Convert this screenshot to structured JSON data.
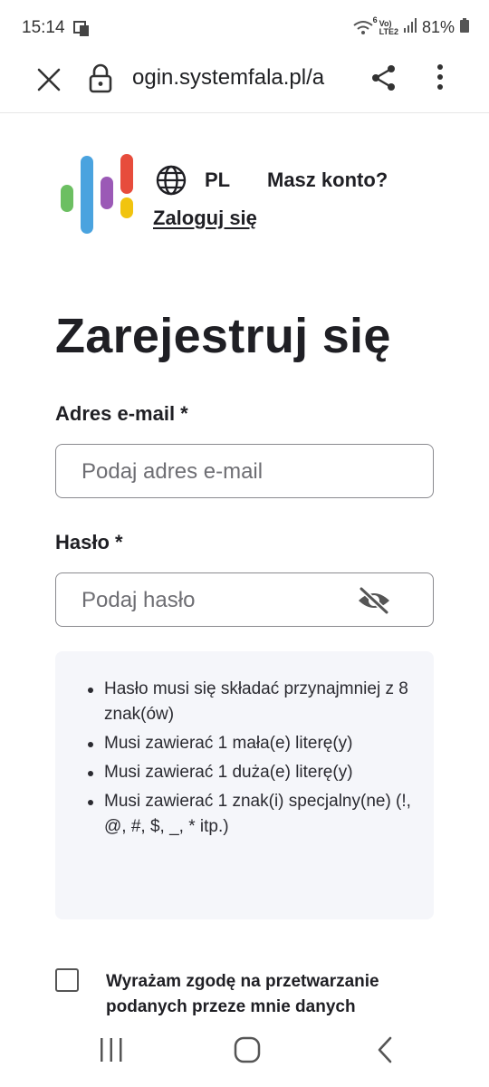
{
  "status_bar": {
    "time": "15:14",
    "net_small_1": "6",
    "net_small_2": "Vo)",
    "net_small_3": "LTE2",
    "battery": "81%"
  },
  "browser": {
    "url": "ogin.systemfala.pl/a"
  },
  "header": {
    "language": "PL",
    "account_question": "Masz konto?",
    "login_link": "Zaloguj się"
  },
  "logo_colors": [
    "#6cbf62",
    "#4aa3df",
    "#9b59b6",
    "#e74c3c",
    "#f1c40f"
  ],
  "form": {
    "title": "Zarejestruj się",
    "email": {
      "label": "Adres e-mail *",
      "placeholder": "Podaj adres e-mail",
      "value": ""
    },
    "password": {
      "label": "Hasło *",
      "placeholder": "Podaj hasło",
      "value": ""
    },
    "requirements": [
      "Hasło musi się składać przynajmniej z 8 znak(ów)",
      "Musi zawierać 1 mała(e) literę(y)",
      "Musi zawierać 1 duża(e) literę(y)",
      "Musi zawierać 1 znak(i) specjalny(ne) (!, @, #, $, _, * itp.)"
    ],
    "consent": {
      "text": "Wyrażam zgodę na przetwarzanie podanych przeze mnie danych",
      "checked": false
    }
  },
  "icons": {
    "close": "close-icon",
    "lock": "lock-icon",
    "share": "share-icon",
    "menu": "more-vert-icon",
    "globe": "globe-icon",
    "eye": "eye-off-icon",
    "recents": "recents-icon",
    "home": "home-icon",
    "back": "back-icon"
  }
}
